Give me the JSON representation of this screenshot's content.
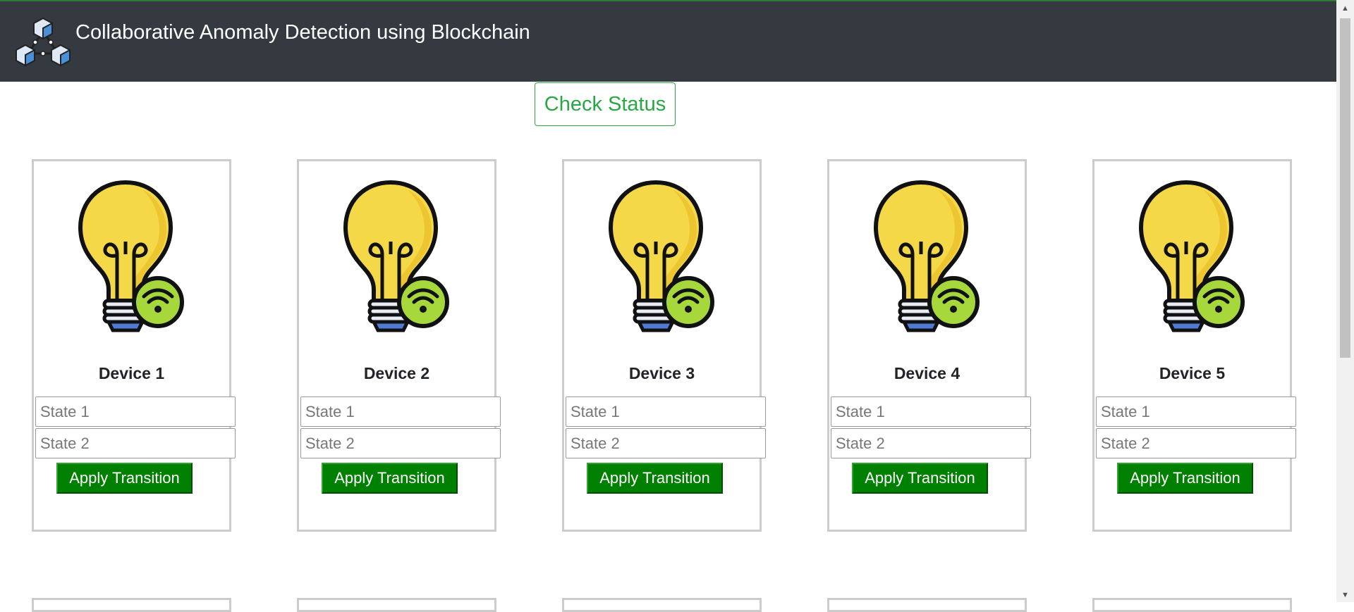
{
  "header": {
    "title": "Collaborative Anomaly Detection using Blockchain"
  },
  "actions": {
    "check_status_label": "Check Status"
  },
  "colors": {
    "navbar": "#343a40",
    "accent_green": "#28a745",
    "apply_button": "#008000",
    "bulb_yellow": "#f5d848",
    "wifi_green": "#a6d83c"
  },
  "devices": [
    {
      "name": "Device 1",
      "state1_placeholder": "State 1",
      "state2_placeholder": "State 2",
      "apply_label": "Apply Transition"
    },
    {
      "name": "Device 2",
      "state1_placeholder": "State 1",
      "state2_placeholder": "State 2",
      "apply_label": "Apply Transition"
    },
    {
      "name": "Device 3",
      "state1_placeholder": "State 1",
      "state2_placeholder": "State 2",
      "apply_label": "Apply Transition"
    },
    {
      "name": "Device 4",
      "state1_placeholder": "State 1",
      "state2_placeholder": "State 2",
      "apply_label": "Apply Transition"
    },
    {
      "name": "Device 5",
      "state1_placeholder": "State 1",
      "state2_placeholder": "State 2",
      "apply_label": "Apply Transition"
    }
  ],
  "icons": {
    "logo": "blockchain-cubes-icon",
    "device": "smart-bulb-wifi-icon"
  }
}
